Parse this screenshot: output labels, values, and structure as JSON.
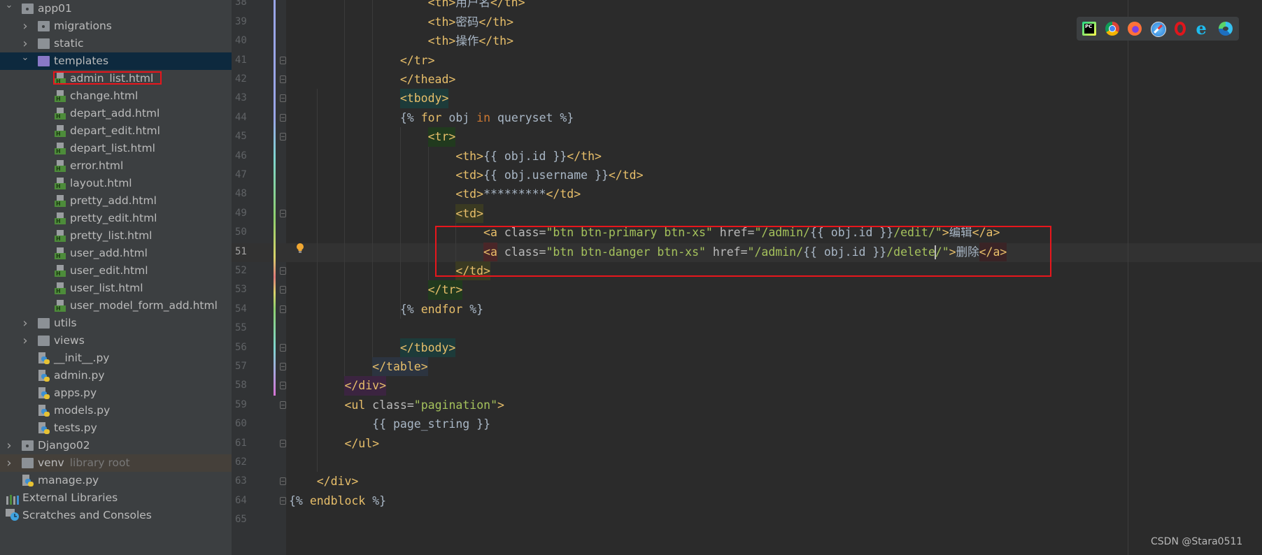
{
  "project_tree": [
    {
      "label": "app01",
      "level": 0,
      "kind": "pkg-folder",
      "expanded": true
    },
    {
      "label": "migrations",
      "level": 1,
      "kind": "pkg-folder",
      "expanded": false
    },
    {
      "label": "static",
      "level": 1,
      "kind": "folder",
      "expanded": false
    },
    {
      "label": "templates",
      "level": 1,
      "kind": "folder-purple",
      "expanded": true,
      "selected": true
    },
    {
      "label": "admin_list.html",
      "level": 2,
      "kind": "html",
      "highlighted": true
    },
    {
      "label": "change.html",
      "level": 2,
      "kind": "html"
    },
    {
      "label": "depart_add.html",
      "level": 2,
      "kind": "html"
    },
    {
      "label": "depart_edit.html",
      "level": 2,
      "kind": "html"
    },
    {
      "label": "depart_list.html",
      "level": 2,
      "kind": "html"
    },
    {
      "label": "error.html",
      "level": 2,
      "kind": "html"
    },
    {
      "label": "layout.html",
      "level": 2,
      "kind": "html"
    },
    {
      "label": "pretty_add.html",
      "level": 2,
      "kind": "html"
    },
    {
      "label": "pretty_edit.html",
      "level": 2,
      "kind": "html"
    },
    {
      "label": "pretty_list.html",
      "level": 2,
      "kind": "html"
    },
    {
      "label": "user_add.html",
      "level": 2,
      "kind": "html"
    },
    {
      "label": "user_edit.html",
      "level": 2,
      "kind": "html"
    },
    {
      "label": "user_list.html",
      "level": 2,
      "kind": "html"
    },
    {
      "label": "user_model_form_add.html",
      "level": 2,
      "kind": "html"
    },
    {
      "label": "utils",
      "level": 1,
      "kind": "folder",
      "expanded": false
    },
    {
      "label": "views",
      "level": 1,
      "kind": "folder",
      "expanded": false
    },
    {
      "label": "__init__.py",
      "level": 1,
      "kind": "py"
    },
    {
      "label": "admin.py",
      "level": 1,
      "kind": "py"
    },
    {
      "label": "apps.py",
      "level": 1,
      "kind": "py"
    },
    {
      "label": "models.py",
      "level": 1,
      "kind": "py"
    },
    {
      "label": "tests.py",
      "level": 1,
      "kind": "py"
    },
    {
      "label": "Django02",
      "level": 0,
      "kind": "pkg-folder",
      "expanded": false
    },
    {
      "label": "venv",
      "level": 0,
      "kind": "folder",
      "expanded": false,
      "suffix": "library root",
      "libroot": true
    },
    {
      "label": "manage.py",
      "level": 0,
      "kind": "py"
    },
    {
      "label": "External Libraries",
      "level": -1,
      "kind": "libs"
    },
    {
      "label": "Scratches and Consoles",
      "level": -1,
      "kind": "scratch"
    }
  ],
  "editor": {
    "current_line": 51,
    "lines": [
      {
        "n": 38,
        "indent": 20,
        "tokens": [
          {
            "c": "tag",
            "v": "<th>"
          },
          {
            "c": "text",
            "v": "用户名"
          },
          {
            "c": "tag",
            "v": "</th>"
          }
        ]
      },
      {
        "n": 39,
        "indent": 20,
        "tokens": [
          {
            "c": "tag",
            "v": "<th>"
          },
          {
            "c": "text",
            "v": "密码"
          },
          {
            "c": "tag",
            "v": "</th>"
          }
        ]
      },
      {
        "n": 40,
        "indent": 20,
        "tokens": [
          {
            "c": "tag",
            "v": "<th>"
          },
          {
            "c": "text",
            "v": "操作"
          },
          {
            "c": "tag",
            "v": "</th>"
          }
        ]
      },
      {
        "n": 41,
        "indent": 16,
        "fold": true,
        "tokens": [
          {
            "c": "tag",
            "v": "</tr>"
          }
        ]
      },
      {
        "n": 42,
        "indent": 16,
        "fold": true,
        "tokens": [
          {
            "c": "tag",
            "v": "</thead>"
          }
        ]
      },
      {
        "n": 43,
        "indent": 16,
        "fold": true,
        "tokens": [
          {
            "c": "tag",
            "v": "<tbody>",
            "bg": "#1d3b3a"
          }
        ]
      },
      {
        "n": 44,
        "indent": 16,
        "fold": true,
        "tokens": [
          {
            "c": "text",
            "v": "{% "
          },
          {
            "c": "kw",
            "v": "for"
          },
          {
            "c": "text",
            "v": " obj "
          },
          {
            "c": "kw2",
            "v": "in"
          },
          {
            "c": "text",
            "v": " queryset %}"
          }
        ]
      },
      {
        "n": 45,
        "indent": 20,
        "fold": true,
        "tokens": [
          {
            "c": "tag",
            "v": "<tr>",
            "bg": "#213a1e"
          }
        ]
      },
      {
        "n": 46,
        "indent": 24,
        "tokens": [
          {
            "c": "tag",
            "v": "<th>"
          },
          {
            "c": "text",
            "v": "{{ obj.id }}"
          },
          {
            "c": "tag",
            "v": "</th>"
          }
        ]
      },
      {
        "n": 47,
        "indent": 24,
        "tokens": [
          {
            "c": "tag",
            "v": "<td>"
          },
          {
            "c": "text",
            "v": "{{ obj.username }}"
          },
          {
            "c": "tag",
            "v": "</td>"
          }
        ]
      },
      {
        "n": 48,
        "indent": 24,
        "tokens": [
          {
            "c": "tag",
            "v": "<td>"
          },
          {
            "c": "text",
            "v": "*********"
          },
          {
            "c": "tag",
            "v": "</td>"
          }
        ]
      },
      {
        "n": 49,
        "indent": 24,
        "fold": true,
        "tokens": [
          {
            "c": "tag",
            "v": "<td>",
            "bg": "#3a3a22"
          }
        ]
      },
      {
        "n": 50,
        "indent": 28,
        "tokens": [
          {
            "c": "tag",
            "v": "<a"
          },
          {
            "c": "attr",
            "v": " class="
          },
          {
            "c": "val",
            "v": "\"btn btn-primary btn-xs\""
          },
          {
            "c": "attr",
            "v": " href="
          },
          {
            "c": "val",
            "v": "\"/admin/"
          },
          {
            "c": "text",
            "v": "{{ obj.id }}"
          },
          {
            "c": "val",
            "v": "/edit/\""
          },
          {
            "c": "tag",
            "v": ">"
          },
          {
            "c": "text",
            "v": "编辑"
          },
          {
            "c": "tag",
            "v": "</a>"
          }
        ]
      },
      {
        "n": 51,
        "indent": 28,
        "tokens": [
          {
            "c": "tag",
            "v": "<a",
            "bg": "#4a2628"
          },
          {
            "c": "attr",
            "v": " class="
          },
          {
            "c": "val",
            "v": "\"btn btn-danger btn-xs\""
          },
          {
            "c": "attr",
            "v": " href="
          },
          {
            "c": "val",
            "v": "\"/admin/"
          },
          {
            "c": "text",
            "v": "{{ obj.id }}"
          },
          {
            "c": "val",
            "v": "/delete",
            "caret": true
          },
          {
            "c": "val",
            "v": "/\""
          },
          {
            "c": "tag",
            "v": ">"
          },
          {
            "c": "text",
            "v": "删除"
          },
          {
            "c": "tag",
            "v": "</a>",
            "bg": "#3a2426"
          }
        ]
      },
      {
        "n": 52,
        "indent": 24,
        "fold": true,
        "tokens": [
          {
            "c": "tag",
            "v": "</td>",
            "bg": "#3a3a22"
          }
        ]
      },
      {
        "n": 53,
        "indent": 20,
        "fold": true,
        "tokens": [
          {
            "c": "tag",
            "v": "</tr>",
            "bg": "#213a1e"
          }
        ]
      },
      {
        "n": 54,
        "indent": 16,
        "fold": true,
        "tokens": [
          {
            "c": "text",
            "v": "{% "
          },
          {
            "c": "kw",
            "v": "endfor"
          },
          {
            "c": "text",
            "v": " %}"
          }
        ]
      },
      {
        "n": 55,
        "indent": 0,
        "tokens": []
      },
      {
        "n": 56,
        "indent": 16,
        "fold": true,
        "tokens": [
          {
            "c": "tag",
            "v": "</tbody>",
            "bg": "#1d3b3a"
          }
        ]
      },
      {
        "n": 57,
        "indent": 12,
        "fold": true,
        "tokens": [
          {
            "c": "tag",
            "v": "</table>",
            "bg": "#2c3440"
          }
        ]
      },
      {
        "n": 58,
        "indent": 8,
        "fold": true,
        "tokens": [
          {
            "c": "tag",
            "v": "</div>",
            "bg": "#3b2440"
          }
        ]
      },
      {
        "n": 59,
        "indent": 8,
        "fold": true,
        "tokens": [
          {
            "c": "tag",
            "v": "<ul"
          },
          {
            "c": "attr",
            "v": " class="
          },
          {
            "c": "val",
            "v": "\"pagination\""
          },
          {
            "c": "tag",
            "v": ">"
          }
        ]
      },
      {
        "n": 60,
        "indent": 12,
        "tokens": [
          {
            "c": "text",
            "v": "{{ page_string }}"
          }
        ]
      },
      {
        "n": 61,
        "indent": 8,
        "fold": true,
        "tokens": [
          {
            "c": "tag",
            "v": "</ul>"
          }
        ]
      },
      {
        "n": 62,
        "indent": 0,
        "tokens": []
      },
      {
        "n": 63,
        "indent": 4,
        "fold": true,
        "tokens": [
          {
            "c": "tag",
            "v": "</div>"
          }
        ]
      },
      {
        "n": 64,
        "indent": 0,
        "fold": true,
        "tokens": [
          {
            "c": "text",
            "v": "{% "
          },
          {
            "c": "kw",
            "v": "endblock"
          },
          {
            "c": "text",
            "v": " %}"
          }
        ]
      },
      {
        "n": 65,
        "indent": 0,
        "tokens": []
      }
    ]
  },
  "browser_icons": [
    {
      "name": "pycharm-icon",
      "color": "#21d789"
    },
    {
      "name": "chrome-icon",
      "color": "#4285f4"
    },
    {
      "name": "firefox-icon",
      "color": "#ff7139"
    },
    {
      "name": "safari-icon",
      "color": "#4aa3f0"
    },
    {
      "name": "opera-icon",
      "color": "#e0161c"
    },
    {
      "name": "ie-icon",
      "color": "#1ebbee"
    },
    {
      "name": "edge-icon",
      "color": "#1d8fd8"
    }
  ],
  "watermark": "CSDN @Stara0511",
  "colors": {
    "annotation_red": "#e8161c",
    "selection": "#0d293e"
  }
}
